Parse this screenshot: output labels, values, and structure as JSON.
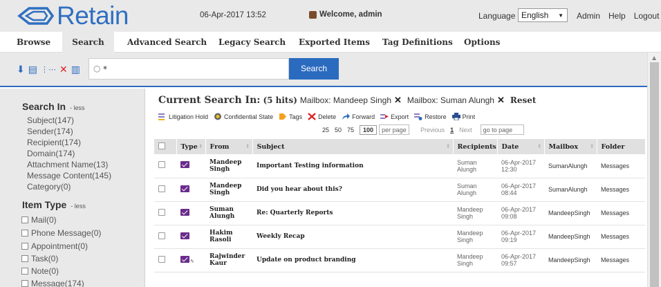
{
  "header": {
    "logo_text": "Retain",
    "datetime": "06-Apr-2017 13:52",
    "welcome": "Welcome, admin",
    "language_label": "Language",
    "language_value": "English",
    "links": [
      "Admin",
      "Help",
      "Logout"
    ]
  },
  "nav": {
    "tabs": [
      "Browse",
      "Search",
      "Advanced Search",
      "Legacy Search",
      "Exported Items",
      "Tag Definitions",
      "Options"
    ],
    "active": "Search"
  },
  "toolbar": {
    "search_value": "*",
    "search_button": "Search",
    "icons": [
      "download-icon",
      "save-icon",
      "share-icon",
      "delete-icon",
      "copy-icon"
    ]
  },
  "left": {
    "search_in_title": "Search In",
    "less": "- less",
    "search_in_items": [
      "Subject(147)",
      "Sender(174)",
      "Recipient(174)",
      "Domain(174)",
      "Attachment Name(13)",
      "Message Content(145)",
      "Category(0)"
    ],
    "item_type_title": "Item Type",
    "item_type_items": [
      "Mail(0)",
      "Phone Message(0)",
      "Appointment(0)",
      "Task(0)",
      "Note(0)",
      "Message(174)"
    ]
  },
  "main": {
    "current_search_label": "Current Search In:",
    "hits": "(5 hits)",
    "mailbox_filters": [
      "Mailbox: Mandeep Singh",
      "Mailbox: Suman Alungh"
    ],
    "reset": "Reset",
    "actions": [
      "Litigation Hold",
      "Confidential State",
      "Tags",
      "Delete",
      "Forward",
      "Export",
      "Restore",
      "Print"
    ],
    "pager": {
      "sizes": [
        "25",
        "50",
        "75",
        "100"
      ],
      "selected_size": "100",
      "per_page": "per page",
      "previous": "Previous",
      "current": "1",
      "next": "Next",
      "goto": "go to page"
    },
    "columns": [
      "",
      "Type",
      "From",
      "Subject",
      "Recipients",
      "Date",
      "Mailbox",
      "Folder"
    ],
    "rows": [
      {
        "from": "Mandeep Singh",
        "subject": "Important Testing information",
        "recipients": "Suman Alungh",
        "date": "06-Apr-2017 12:30",
        "mailbox": "SumanAlungh",
        "folder": "Messages"
      },
      {
        "from": "Mandeep Singh",
        "subject": "Did you hear about this?",
        "recipients": "Suman Alungh",
        "date": "06-Apr-2017 08:44",
        "mailbox": "SumanAlungh",
        "folder": "Messages"
      },
      {
        "from": "Suman Alungh",
        "subject": "Re: Quarterly Reports",
        "recipients": "Mandeep Singh",
        "date": "06-Apr-2017 09:08",
        "mailbox": "MandeepSingh",
        "folder": "Messages"
      },
      {
        "from": "Hakim Rasoli",
        "subject": "Weekly Recap",
        "recipients": "Mandeep Singh",
        "date": "06-Apr-2017 09:19",
        "mailbox": "MandeepSingh",
        "folder": "Messages"
      },
      {
        "from": "Rajwinder Kaur",
        "subject": "Update on product branding",
        "recipients": "Mandeep Singh",
        "date": "06-Apr-2017 09:57",
        "mailbox": "MandeepSingh",
        "folder": "Messages"
      }
    ]
  }
}
